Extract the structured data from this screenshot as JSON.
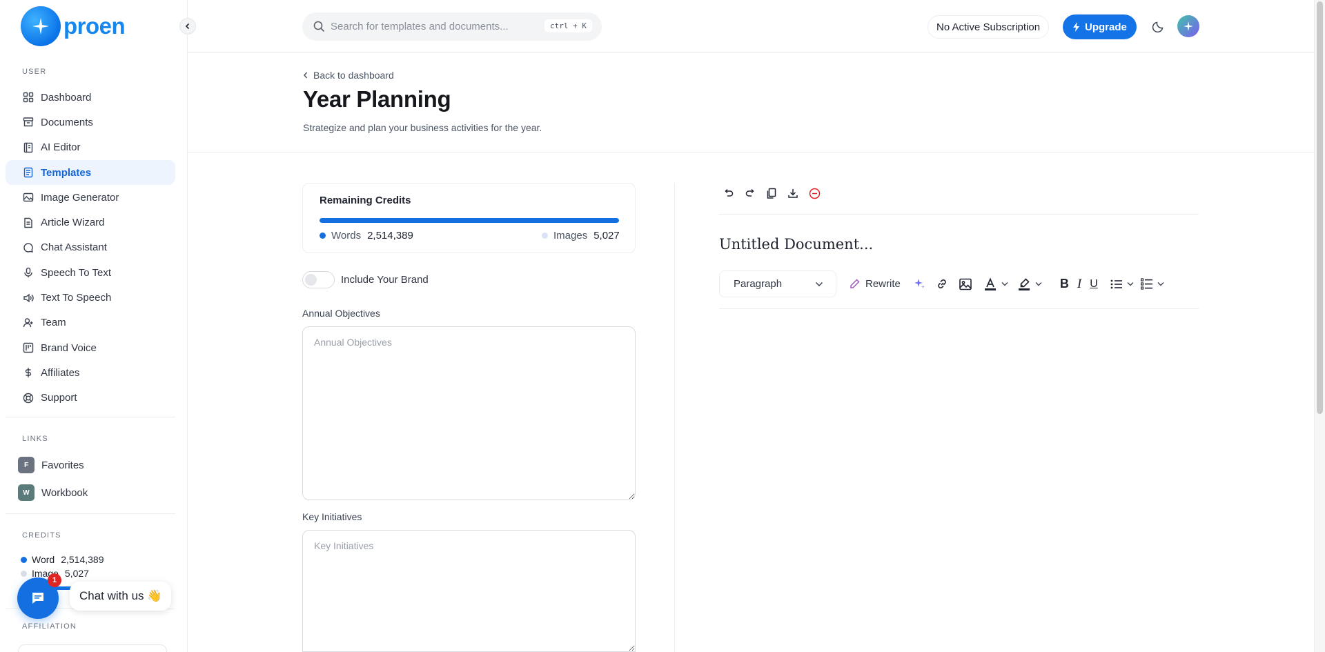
{
  "brand": {
    "name": "proen",
    "accent": "#1473e6"
  },
  "sidebar": {
    "user_section": "USER",
    "items": [
      {
        "label": "Dashboard",
        "icon": "grid-icon"
      },
      {
        "label": "Documents",
        "icon": "archive-icon"
      },
      {
        "label": "AI Editor",
        "icon": "notebook-icon"
      },
      {
        "label": "Templates",
        "icon": "template-icon",
        "active": true
      },
      {
        "label": "Image Generator",
        "icon": "image-icon"
      },
      {
        "label": "Article Wizard",
        "icon": "article-icon"
      },
      {
        "label": "Chat Assistant",
        "icon": "chat-icon"
      },
      {
        "label": "Speech To Text",
        "icon": "microphone-icon"
      },
      {
        "label": "Text To Speech",
        "icon": "speaker-icon"
      },
      {
        "label": "Team",
        "icon": "user-plus-icon"
      },
      {
        "label": "Brand Voice",
        "icon": "brand-icon"
      },
      {
        "label": "Affiliates",
        "icon": "dollar-icon"
      },
      {
        "label": "Support",
        "icon": "lifebuoy-icon"
      }
    ],
    "links_section": "LINKS",
    "links": [
      {
        "badge": "F",
        "label": "Favorites",
        "color": "#6b7280"
      },
      {
        "badge": "W",
        "label": "Workbook",
        "color": "#5b7a7a"
      }
    ],
    "credits_section": "CREDITS",
    "credits": [
      {
        "label": "Word",
        "value": "2,514,389",
        "color": "#1470e0"
      },
      {
        "label": "Image",
        "value": "5,027",
        "color": "#d8dde5"
      }
    ],
    "affiliation_section": "AFFILIATION"
  },
  "chat_widget": {
    "badge": "1",
    "label": "Chat with us 👋"
  },
  "header": {
    "search_placeholder": "Search for templates and documents...",
    "shortcut": "ctrl + K",
    "subscription": "No Active Subscription",
    "upgrade": "Upgrade"
  },
  "page": {
    "back": "Back to dashboard",
    "title": "Year Planning",
    "subtitle": "Strategize and plan your business activities for the year."
  },
  "form": {
    "credits_title": "Remaining Credits",
    "words_label": "Words",
    "words_value": "2,514,389",
    "images_label": "Images",
    "images_value": "5,027",
    "brand_toggle": "Include Your Brand",
    "field1_label": "Annual Objectives",
    "field1_placeholder": "Annual Objectives",
    "field2_label": "Key Initiatives",
    "field2_placeholder": "Key Initiatives"
  },
  "editor": {
    "doc_title": "Untitled Document...",
    "block_type": "Paragraph",
    "rewrite": "Rewrite",
    "bold": "B",
    "italic": "I",
    "underline": "U"
  }
}
